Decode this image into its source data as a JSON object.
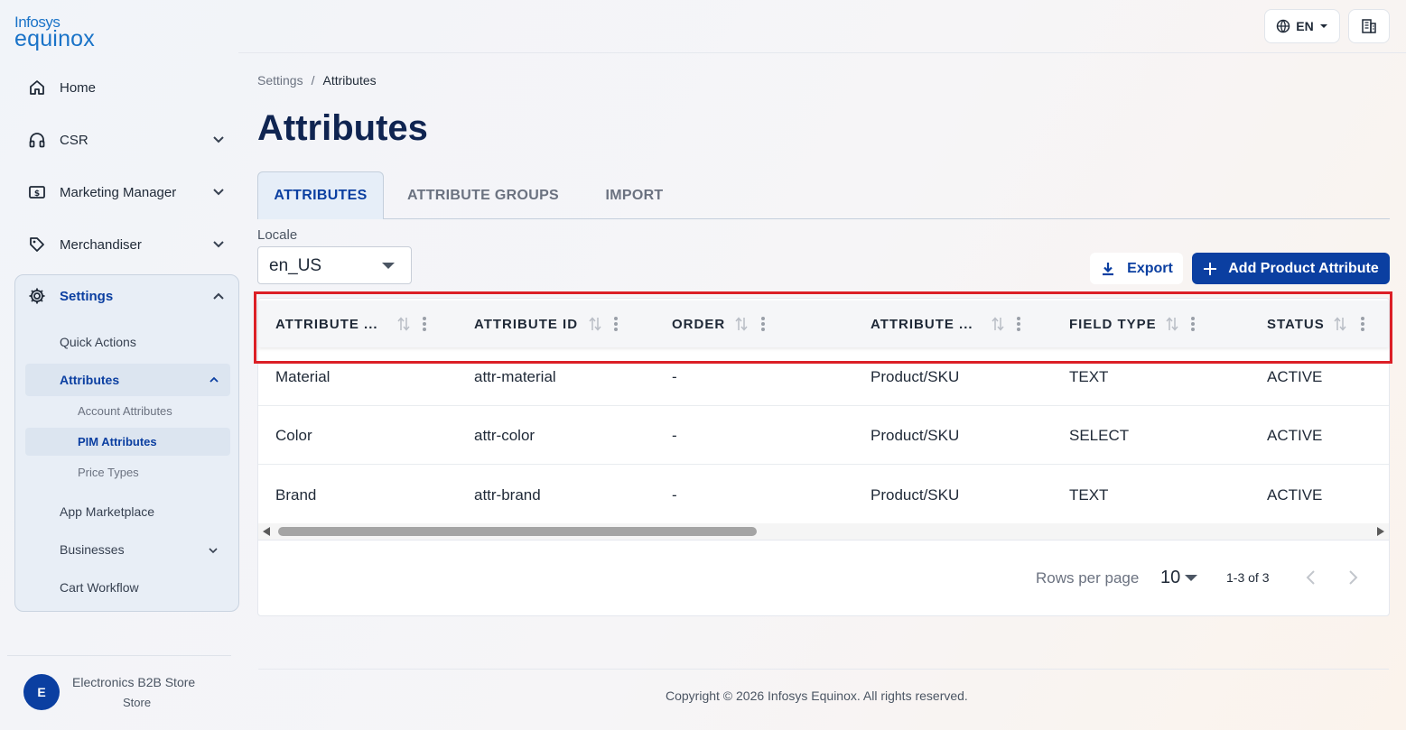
{
  "brand": {
    "line1": "Infosys",
    "line2": "equinox"
  },
  "header": {
    "language": "EN"
  },
  "sidebar": {
    "items": [
      {
        "label": "Home"
      },
      {
        "label": "CSR"
      },
      {
        "label": "Marketing Manager"
      },
      {
        "label": "Merchandiser"
      },
      {
        "label": "Settings"
      }
    ],
    "settings_children": {
      "quick_actions": "Quick Actions",
      "attributes": "Attributes",
      "account_attributes": "Account Attributes",
      "pim_attributes": "PIM Attributes",
      "price_types": "Price Types",
      "app_marketplace": "App Marketplace",
      "businesses": "Businesses",
      "cart_workflow": "Cart Workflow"
    },
    "store": {
      "avatar_letter": "E",
      "name": "Electronics B2B Store",
      "type": "Store"
    }
  },
  "breadcrumb": {
    "parent": "Settings",
    "separator": "/",
    "current": "Attributes"
  },
  "page": {
    "title": "Attributes"
  },
  "tabs": [
    {
      "label": "ATTRIBUTES"
    },
    {
      "label": "ATTRIBUTE GROUPS"
    },
    {
      "label": "IMPORT"
    }
  ],
  "locale": {
    "label": "Locale",
    "value": "en_US"
  },
  "actions": {
    "export": "Export",
    "add": "Add Product Attribute"
  },
  "table": {
    "columns": [
      "ATTRIBUTE ...",
      "ATTRIBUTE ID",
      "ORDER",
      "ATTRIBUTE ...",
      "FIELD TYPE",
      "STATUS"
    ],
    "rows": [
      [
        "Material",
        "attr-material",
        "-",
        "Product/SKU",
        "TEXT",
        "ACTIVE"
      ],
      [
        "Color",
        "attr-color",
        "-",
        "Product/SKU",
        "SELECT",
        "ACTIVE"
      ],
      [
        "Brand",
        "attr-brand",
        "-",
        "Product/SKU",
        "TEXT",
        "ACTIVE"
      ]
    ]
  },
  "pagination": {
    "rows_per_page_label": "Rows per page",
    "rows_per_page": "10",
    "range": "1-3 of 3"
  },
  "footer": {
    "copyright": "Copyright © 2026 Infosys Equinox. All rights reserved."
  },
  "colors": {
    "primary": "#0b3fa1",
    "title": "#0f2451",
    "highlight": "#dc1f26"
  }
}
